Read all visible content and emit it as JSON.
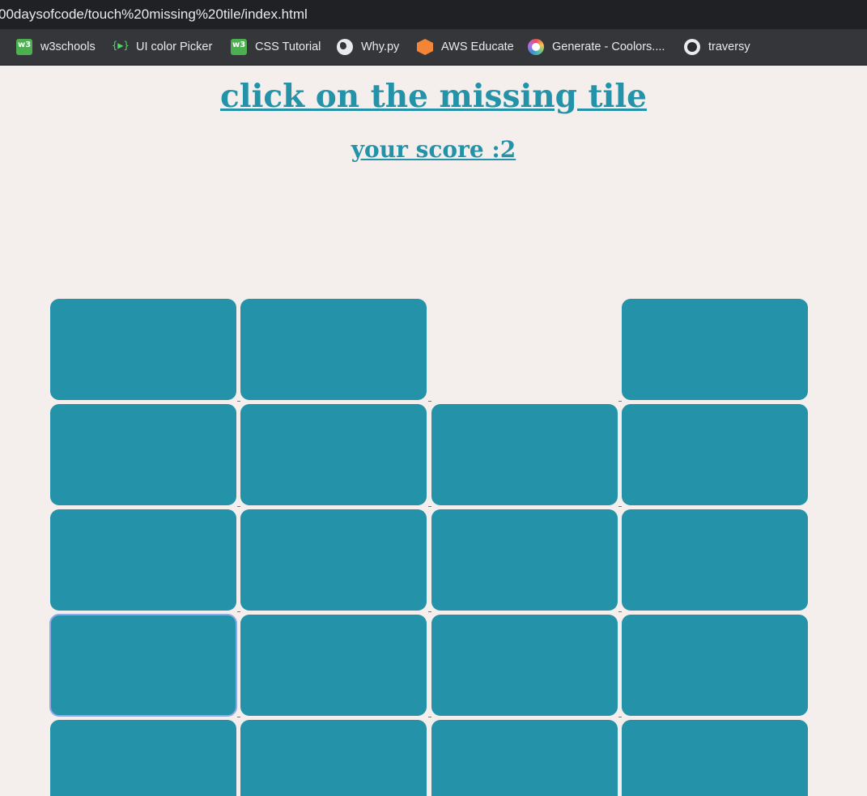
{
  "browser": {
    "url": "00daysofcode/touch%20missing%20tile/index.html",
    "bookmarks": [
      {
        "label": "w3schools",
        "icon": "w3schools-icon"
      },
      {
        "label": "UI color Picker",
        "icon": "color-picker-icon"
      },
      {
        "label": "CSS Tutorial",
        "icon": "w3schools-icon"
      },
      {
        "label": "Why.py",
        "icon": "globe-icon"
      },
      {
        "label": "AWS Educate",
        "icon": "aws-icon"
      },
      {
        "label": "Generate - Coolors....",
        "icon": "coolors-icon"
      },
      {
        "label": "traversy",
        "icon": "github-icon"
      }
    ]
  },
  "game": {
    "title": "click on the missing tile",
    "score_label": "your score :2",
    "tile_color": "#2492a8",
    "background_color": "#f4efec",
    "columns": 4,
    "missing_tile": {
      "row": 0,
      "col": 2
    },
    "focused_tile": {
      "row": 3,
      "col": 0
    }
  }
}
